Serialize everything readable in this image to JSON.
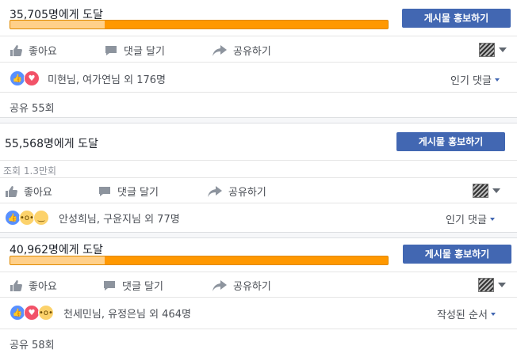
{
  "posts": [
    {
      "reach": "35,705명에게 도달",
      "promote": "게시물 홍보하기",
      "progress": 0.25,
      "actions": {
        "like": "좋아요",
        "comment": "댓글 달기",
        "share": "공유하기"
      },
      "reactions": {
        "icons": [
          "like-icon",
          "love-icon"
        ],
        "names": "미현님, 여가연님 외 176명"
      },
      "sort": "인기 댓글",
      "shares": "공유 55회"
    },
    {
      "reach": "55,568명에게 도달",
      "promote": "게시물 홍보하기",
      "views": "조회 1.3만회",
      "actions": {
        "like": "좋아요",
        "comment": "댓글 달기",
        "share": "공유하기"
      },
      "reactions": {
        "icons": [
          "like-icon",
          "wow-icon",
          "haha-icon"
        ],
        "names": "안성희님, 구윤지님 외 77명"
      },
      "sort": "인기 댓글"
    },
    {
      "reach": "40,962명에게 도달",
      "promote": "게시물 홍보하기",
      "progress": 0.25,
      "actions": {
        "like": "좋아요",
        "comment": "댓글 달기",
        "share": "공유하기"
      },
      "reactions": {
        "icons": [
          "like-icon",
          "love-icon",
          "wow-icon"
        ],
        "names": "천세민님, 유정은님 외 464명"
      },
      "sort": "작성된 순서",
      "shares": "공유 58회"
    }
  ],
  "colors": {
    "accent": "#4267b2",
    "progress": "#ff9800",
    "progress_light": "#ffd08a"
  }
}
